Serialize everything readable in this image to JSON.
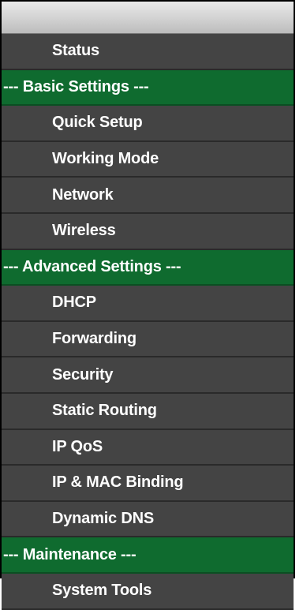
{
  "menu": {
    "items": [
      {
        "type": "item",
        "label": "Status"
      },
      {
        "type": "group",
        "label": "--- Basic Settings ---"
      },
      {
        "type": "item",
        "label": "Quick Setup"
      },
      {
        "type": "item",
        "label": "Working Mode"
      },
      {
        "type": "item",
        "label": "Network"
      },
      {
        "type": "item",
        "label": "Wireless"
      },
      {
        "type": "group",
        "label": "--- Advanced Settings ---"
      },
      {
        "type": "item",
        "label": "DHCP"
      },
      {
        "type": "item",
        "label": "Forwarding"
      },
      {
        "type": "item",
        "label": "Security"
      },
      {
        "type": "item",
        "label": "Static Routing"
      },
      {
        "type": "item",
        "label": "IP QoS"
      },
      {
        "type": "item",
        "label": "IP & MAC Binding"
      },
      {
        "type": "item",
        "label": "Dynamic DNS"
      },
      {
        "type": "group",
        "label": "--- Maintenance ---"
      },
      {
        "type": "item",
        "label": "System Tools"
      }
    ]
  },
  "colors": {
    "item_background": "#444444",
    "group_background": "#0f6b2f",
    "text": "#ffffff"
  }
}
